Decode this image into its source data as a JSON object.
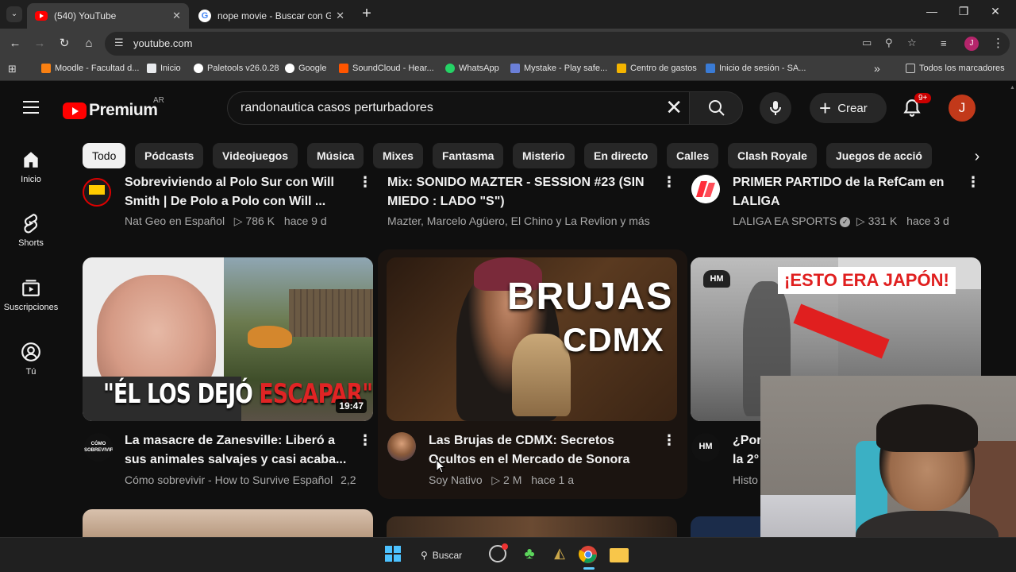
{
  "browser": {
    "tabs": [
      {
        "title": "(540) YouTube",
        "active": true
      },
      {
        "title": "nope movie - Buscar con Googl",
        "active": false
      }
    ],
    "url": "youtube.com",
    "bookmarks": [
      "Moodle - Facultad d...",
      "Inicio",
      "Paletools v26.0.28",
      "Google",
      "SoundCloud - Hear...",
      "WhatsApp",
      "Mystake - Play safe...",
      "Centro de gastos",
      "Inicio de sesión - SA..."
    ],
    "bookmarks_more": "»",
    "all_bookmarks": "Todos los marcadores"
  },
  "youtube": {
    "logo_text": "Premium",
    "country": "AR",
    "search_query": "randonautica casos perturbadores",
    "create_label": "Crear",
    "notification_count": "9+",
    "avatar_letter": "J",
    "guide": [
      {
        "label": "Inicio",
        "icon": "home-icon"
      },
      {
        "label": "Shorts",
        "icon": "shorts-icon"
      },
      {
        "label": "Suscripciones",
        "icon": "subscriptions-icon"
      },
      {
        "label": "Tú",
        "icon": "you-icon"
      }
    ],
    "chips": [
      "Todo",
      "Pódcasts",
      "Videojuegos",
      "Música",
      "Mixes",
      "Fantasma",
      "Misterio",
      "En directo",
      "Calles",
      "Clash Royale",
      "Juegos de acció"
    ],
    "row1": [
      {
        "title_line1": "Sobreviviendo al Polo Sur con Will",
        "title_line2": "Smith | De Polo a Polo con Will ...",
        "channel": "Nat Geo en Español",
        "views": "786 K",
        "age": "hace 9 d"
      },
      {
        "title_line1": "Mix: SONIDO MAZTER - SESSION #23 (SIN",
        "title_line2": "MIEDO : LADO \"S\")",
        "channel": "Mazter, Marcelo Agüero, El Chino y La Revlion y más",
        "views": "",
        "age": ""
      },
      {
        "title_line1": "PRIMER PARTIDO de la RefCam en",
        "title_line2": "LALIGA",
        "channel": "LALIGA EA SPORTS",
        "views": "331 K",
        "age": "hace 3 d"
      }
    ],
    "row2": [
      {
        "thumb_text_white": "\"ÉL LOS DEJÓ ",
        "thumb_text_red": "ESCAPAR\"",
        "duration": "19:47",
        "title_line1": "La masacre de Zanesville: Liberó a",
        "title_line2": "sus animales salvajes y casi acaba...",
        "channel": "Cómo sobrevivir - How to Survive Español",
        "views": "2,2",
        "age": "",
        "channel_badge": "CÓMO SOBREVIVIR"
      },
      {
        "thumb_text_1": "BRUJAS",
        "thumb_text_2": "CDMX",
        "title_line1": "Las Brujas de CDMX: Secretos",
        "title_line2": "Ocultos en el Mercado de Sonora",
        "channel": "Soy Nativo",
        "views": "2 M",
        "age": "hace 1 a"
      },
      {
        "thumb_banner": "¡ESTO ERA JAPÓN!",
        "thumb_badge": "HM",
        "title_line1": "¿Por",
        "title_line2": "la 2°",
        "channel": "Histo",
        "channel_badge": "HM"
      }
    ]
  },
  "taskbar": {
    "search_label": "Buscar"
  },
  "colors": {
    "yt_red": "#ff0000",
    "bg": "#0f0f0f",
    "chip_bg": "#272727"
  }
}
